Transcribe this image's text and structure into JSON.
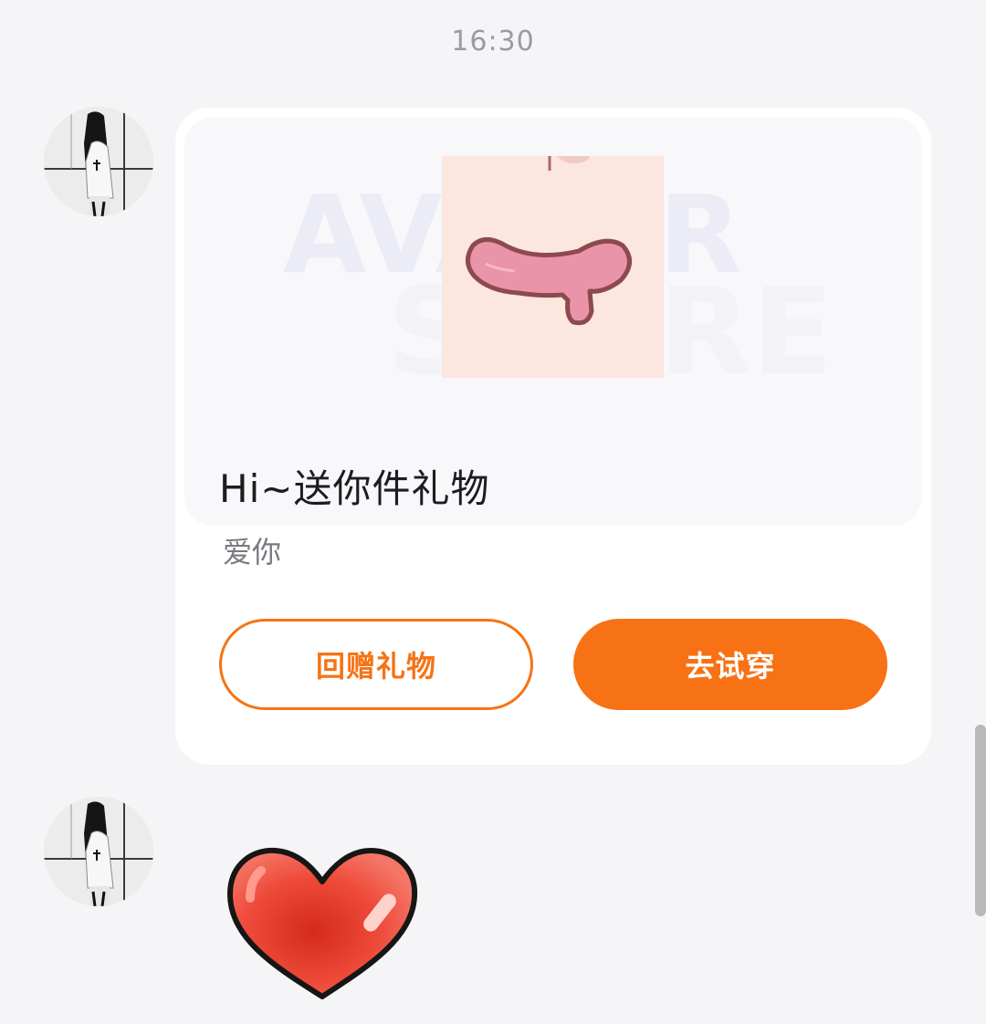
{
  "chat": {
    "timestamp": "16:30",
    "gift_card": {
      "watermark_line_1": "AVATAR",
      "watermark_line_2": "STORE",
      "title": "Hi~送你件礼物",
      "message": "爱你",
      "return_gift_button": "回赠礼物",
      "try_on_button": "去试穿"
    }
  },
  "colors": {
    "accent": "#f77214",
    "background": "#f5f5f7",
    "card": "#ffffff"
  },
  "icons": {
    "avatar": "user-avatar-icon",
    "gift_item": "mouth-sticker-icon",
    "heart": "heart-sticker-icon"
  }
}
